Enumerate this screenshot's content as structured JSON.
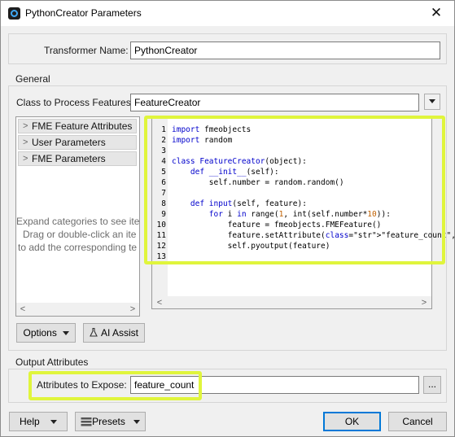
{
  "window": {
    "title": "PythonCreator Parameters",
    "close_glyph": "✕",
    "app_icon": "fme-workbench-icon"
  },
  "transformer": {
    "label": "Transformer Name:",
    "value": "PythonCreator"
  },
  "general": {
    "legend": "General",
    "class_label": "Class to Process Features:",
    "class_value": "FeatureCreator",
    "categories": [
      "FME Feature Attributes",
      "User Parameters",
      "FME Parameters"
    ],
    "hint_lines": [
      "Expand categories to see ite",
      "Drag or double-click an ite",
      "to add the corresponding te"
    ],
    "options_label": "Options",
    "ai_assist_label": "AI Assist"
  },
  "editor": {
    "line_numbers": [
      "1",
      "2",
      "3",
      "4",
      "5",
      "6",
      "7",
      "8",
      "9",
      "10",
      "11",
      "12",
      "13"
    ],
    "code_lines": [
      "import fmeobjects",
      "import random",
      "",
      "class FeatureCreator(object):",
      "    def __init__(self):",
      "        self.number = random.random()",
      "",
      "    def input(self, feature):",
      "        for i in range(1, int(self.number*10)):",
      "            feature = fmeobjects.FMEFeature()",
      "            feature.setAttribute(\"feature_count\", i)",
      "            self.pyoutput(feature)",
      ""
    ]
  },
  "output": {
    "legend": "Output Attributes",
    "expose_label": "Attributes to Expose:",
    "expose_value": "feature_count",
    "ellipsis": "..."
  },
  "footer": {
    "help_label": "Help",
    "presets_label": "Presets",
    "ok_label": "OK",
    "cancel_label": "Cancel"
  },
  "colors": {
    "highlight": "#e0f53c",
    "accent": "#0078d7"
  }
}
